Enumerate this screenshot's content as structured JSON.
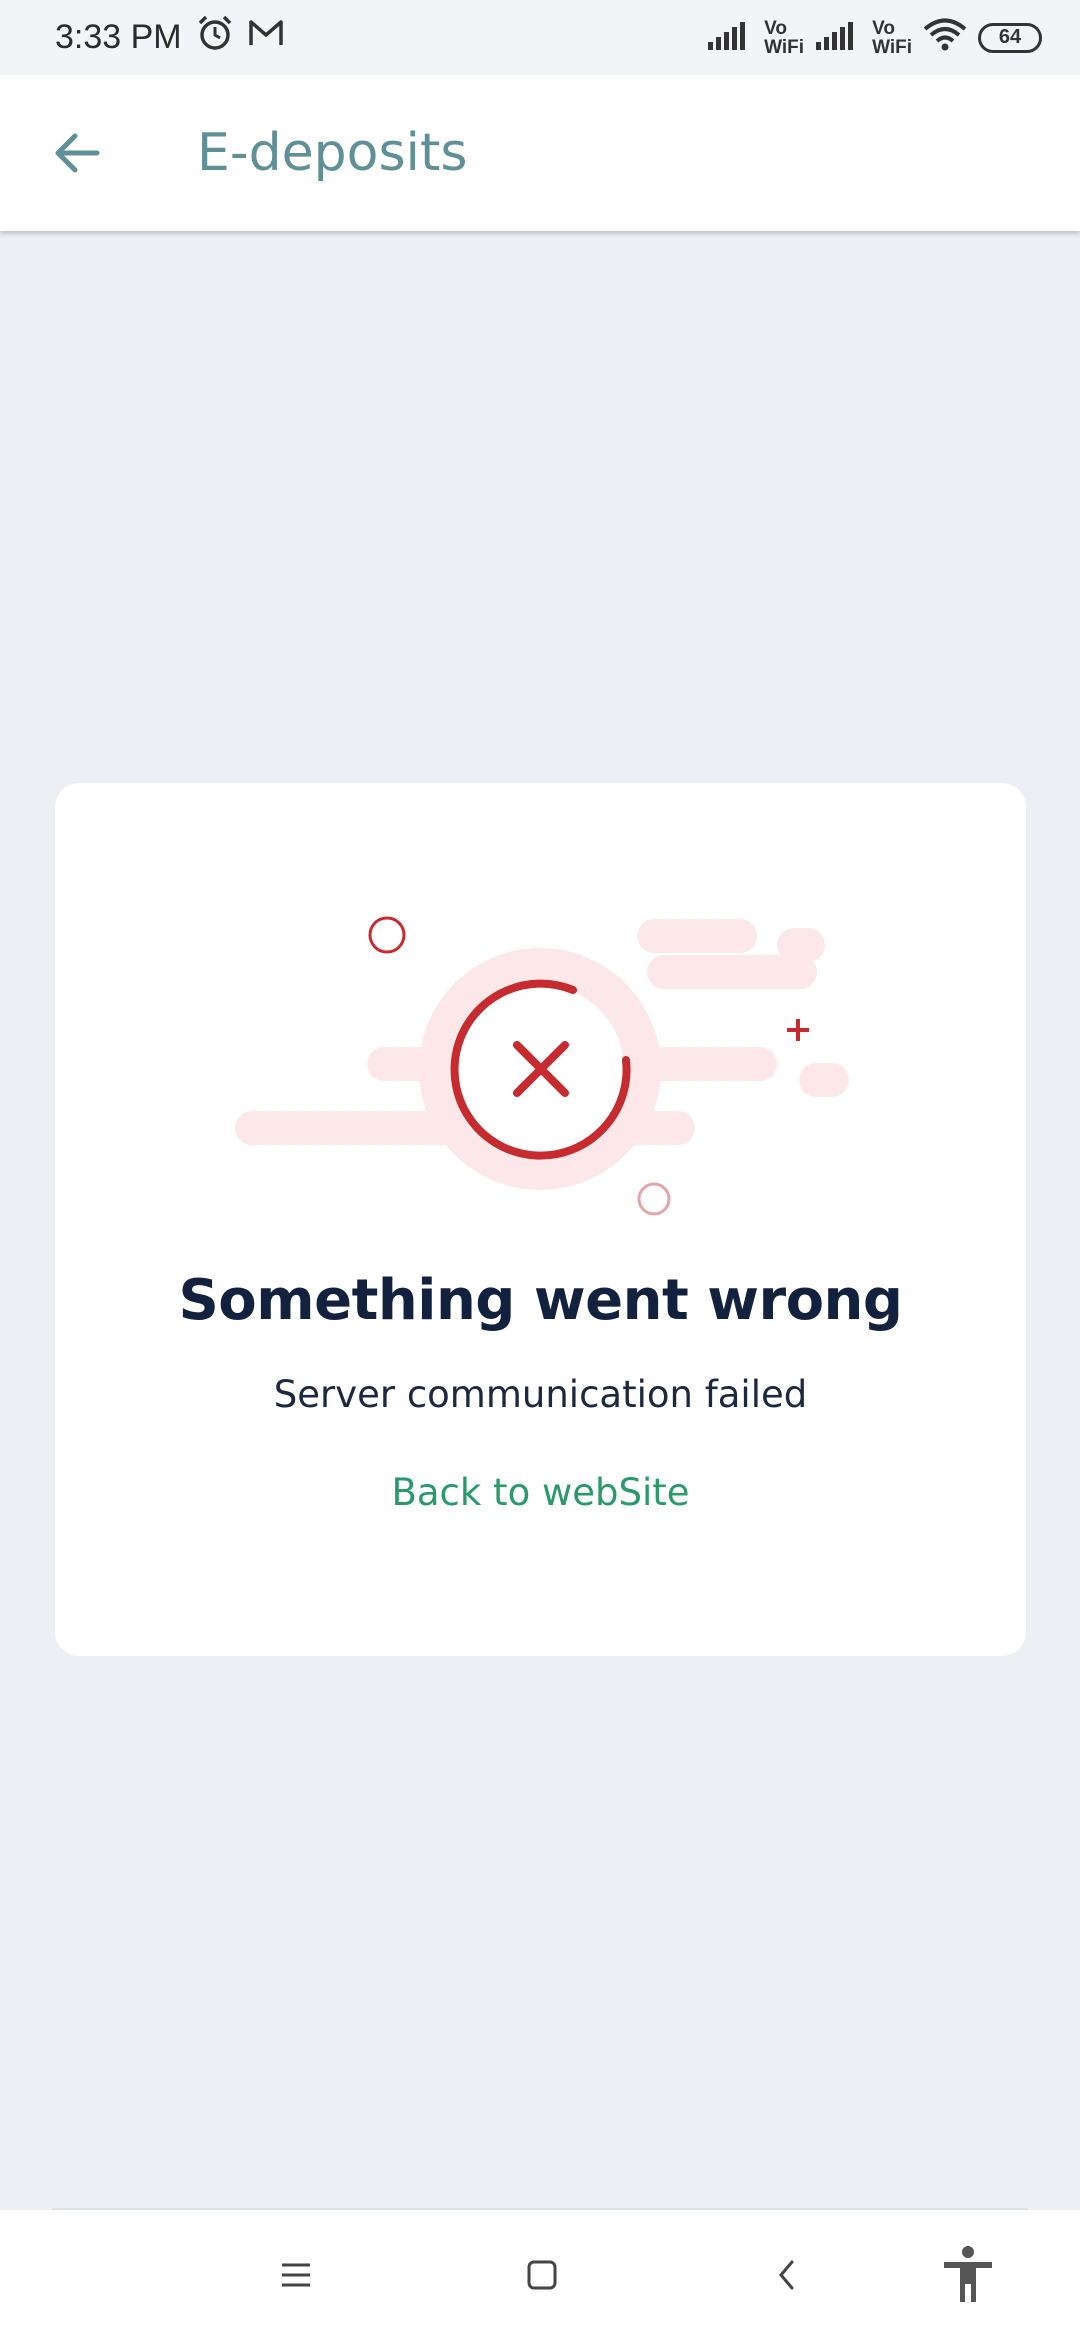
{
  "status_bar": {
    "time": "3:33 PM",
    "icons": [
      "alarm-icon",
      "gmail-icon",
      "signal-icon",
      "vowifi-icon",
      "signal-icon",
      "vowifi-icon",
      "wifi-icon",
      "battery-icon"
    ],
    "vowifi_top": "Vo",
    "vowifi_bottom": "WiFi",
    "battery": "64"
  },
  "app_bar": {
    "title": "E-deposits",
    "back_icon": "arrow-left-icon"
  },
  "error": {
    "title": "Something went wrong",
    "message": "Server communication failed",
    "link": "Back to webSite",
    "colors": {
      "accent": "#c62b2f",
      "cloud": "#fde8e9",
      "link": "#2a9a6b",
      "title": "#12213d"
    }
  },
  "navigation": {
    "icons": [
      "menu-icon",
      "home-square-icon",
      "back-chevron-icon",
      "accessibility-icon"
    ]
  }
}
